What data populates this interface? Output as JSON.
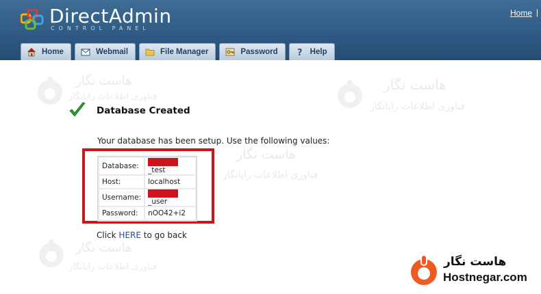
{
  "header": {
    "logo_title": "DirectAdmin",
    "logo_sub": "CONTROL PANEL",
    "home_link": "Home",
    "separator": "|"
  },
  "tabs": [
    {
      "label": "Home",
      "icon": "house-icon"
    },
    {
      "label": "Webmail",
      "icon": "envelope-icon"
    },
    {
      "label": "File Manager",
      "icon": "folder-icon"
    },
    {
      "label": "Password",
      "icon": "key-icon"
    },
    {
      "label": "Help",
      "icon": "question-icon"
    }
  ],
  "content": {
    "title": "Database Created",
    "message": "Your database has been setup. Use the following values:",
    "rows": [
      {
        "key": "Database:",
        "suffix": "_test"
      },
      {
        "key": "Host:",
        "value": "localhost"
      },
      {
        "key": "Username:",
        "suffix": "_user"
      },
      {
        "key": "Password:",
        "value": "nOO42+i2"
      }
    ],
    "back_prefix": "Click",
    "back_link": "HERE",
    "back_suffix": "to go back"
  },
  "watermark": {
    "title": "هاست نگار",
    "subtitle": "فناوری اطلاعات رایانگار"
  },
  "brand": {
    "title": "هاست نگار",
    "url": "Hostnegar.com"
  },
  "colors": {
    "header": "#2f5b84",
    "highlight_box": "#c8161e",
    "brand_orange": "#f05a22",
    "link": "#1f4f9f"
  }
}
